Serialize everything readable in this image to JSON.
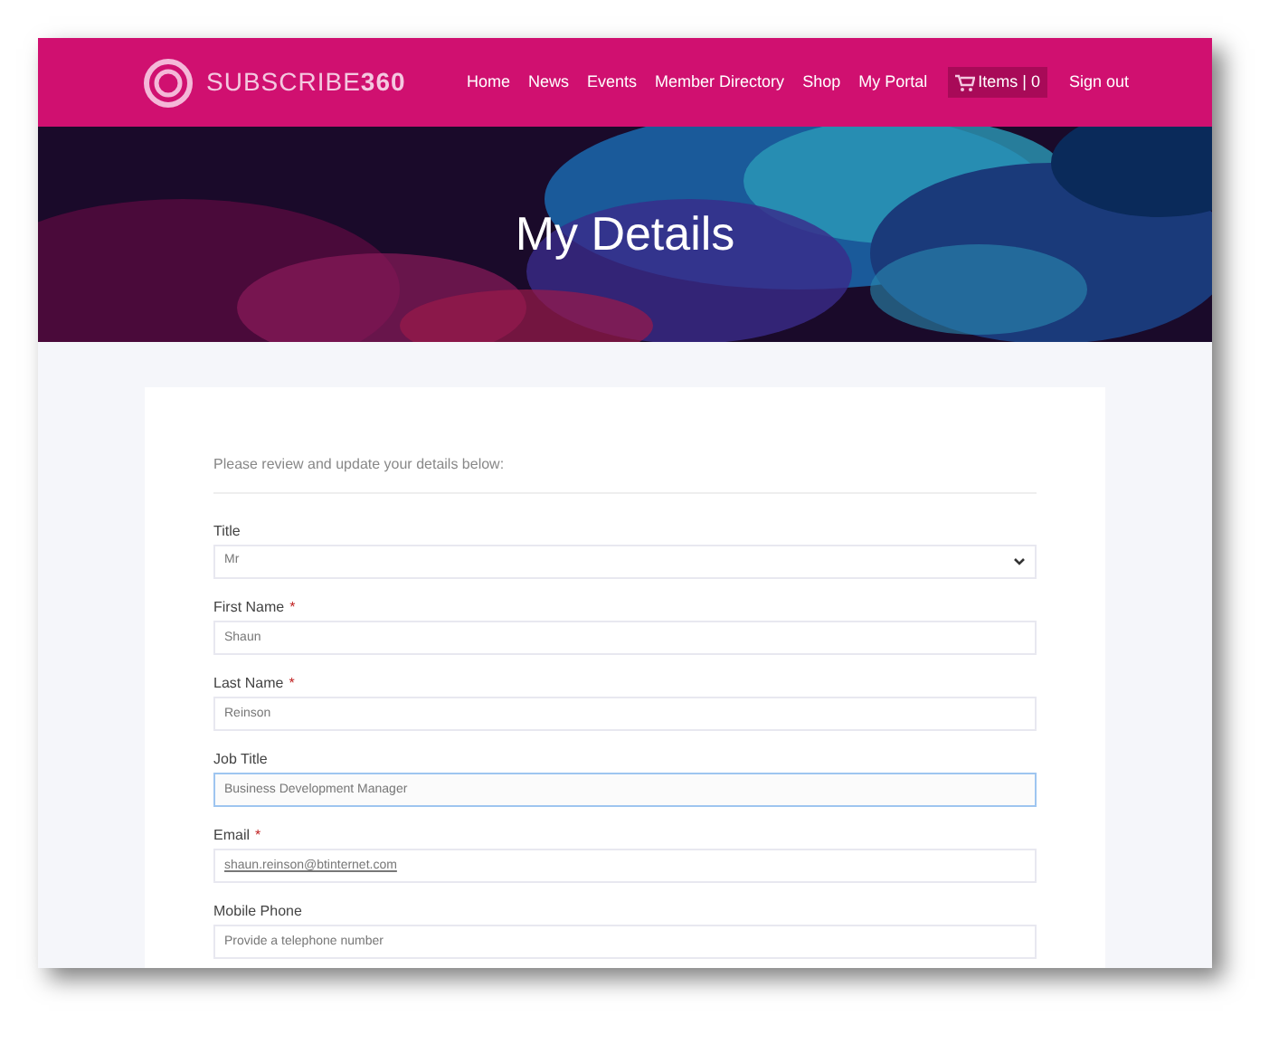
{
  "header": {
    "brand": "SUBSCRIBE**360**",
    "nav": [
      {
        "label": "Home",
        "kind": "link"
      },
      {
        "label": "News",
        "kind": "link"
      },
      {
        "label": "Events",
        "kind": "link"
      },
      {
        "label": "Member Directory",
        "kind": "link"
      },
      {
        "label": "Shop",
        "kind": "link"
      },
      {
        "label": "My Portal",
        "kind": "link"
      },
      {
        "label": "Items | 0",
        "kind": "cart"
      },
      {
        "label": "Sign out",
        "kind": "link"
      }
    ]
  },
  "hero": {
    "title": "My Details",
    "kind": "picture"
  },
  "form": {
    "intro": "Please review and update your details below:",
    "fields": [
      {
        "label": "Title",
        "kind": "select",
        "focused": false,
        "value": "Mr"
      },
      {
        "label": "First Name",
        "kind": "text",
        "marker": "*",
        "focused": false,
        "value": "Shaun"
      },
      {
        "label": "Last Name",
        "kind": "text",
        "marker": "*",
        "focused": false,
        "value": "Reinson"
      },
      {
        "label": "Job Title",
        "kind": "text",
        "focused": true,
        "value": "Business Development Manager"
      },
      {
        "label": "Email",
        "kind": "email",
        "marker": "*",
        "focused": false,
        "value": "shaun.reinson@btinternet.com"
      },
      {
        "label": "Mobile Phone",
        "kind": "text",
        "focused": false,
        "placeholder": "Provide a telephone number"
      }
    ]
  }
}
